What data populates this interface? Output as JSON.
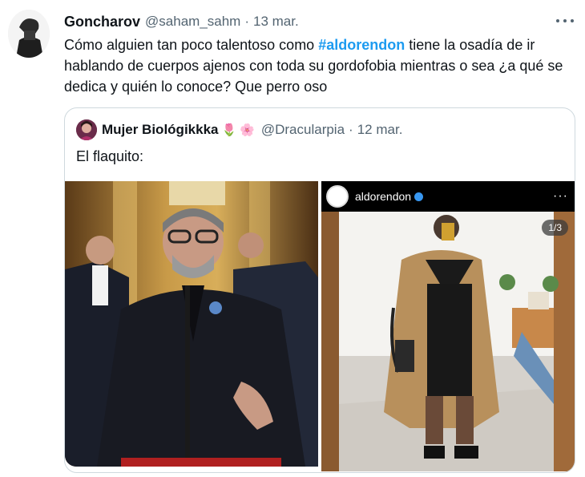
{
  "tweet": {
    "name": "Goncharov",
    "handle": "@saham_sahm",
    "separator": "·",
    "date": "13 mar.",
    "text_before": "Cómo alguien tan poco talentoso como ",
    "hashtag": "#aldorendon",
    "text_after": " tiene la osadía de ir hablando de cuerpos ajenos con toda su gordofobia mientras o sea ¿a qué se dedica y quién lo conoce? Que perro oso",
    "icons": {
      "more": "more-horizontal-icon"
    }
  },
  "quote": {
    "name": "Mujer Biológikkka",
    "emoji_1": "🌷",
    "emoji_2": "🌸",
    "handle": "@Dracularpia",
    "separator": "·",
    "date": "12 mar.",
    "text": "El flaquito:"
  },
  "instagram": {
    "username": "aldorendon",
    "more": "···",
    "counter": "1/3"
  },
  "colors": {
    "link": "#1d9bf0",
    "secondary_text": "#536471",
    "border": "#cfd9de"
  }
}
